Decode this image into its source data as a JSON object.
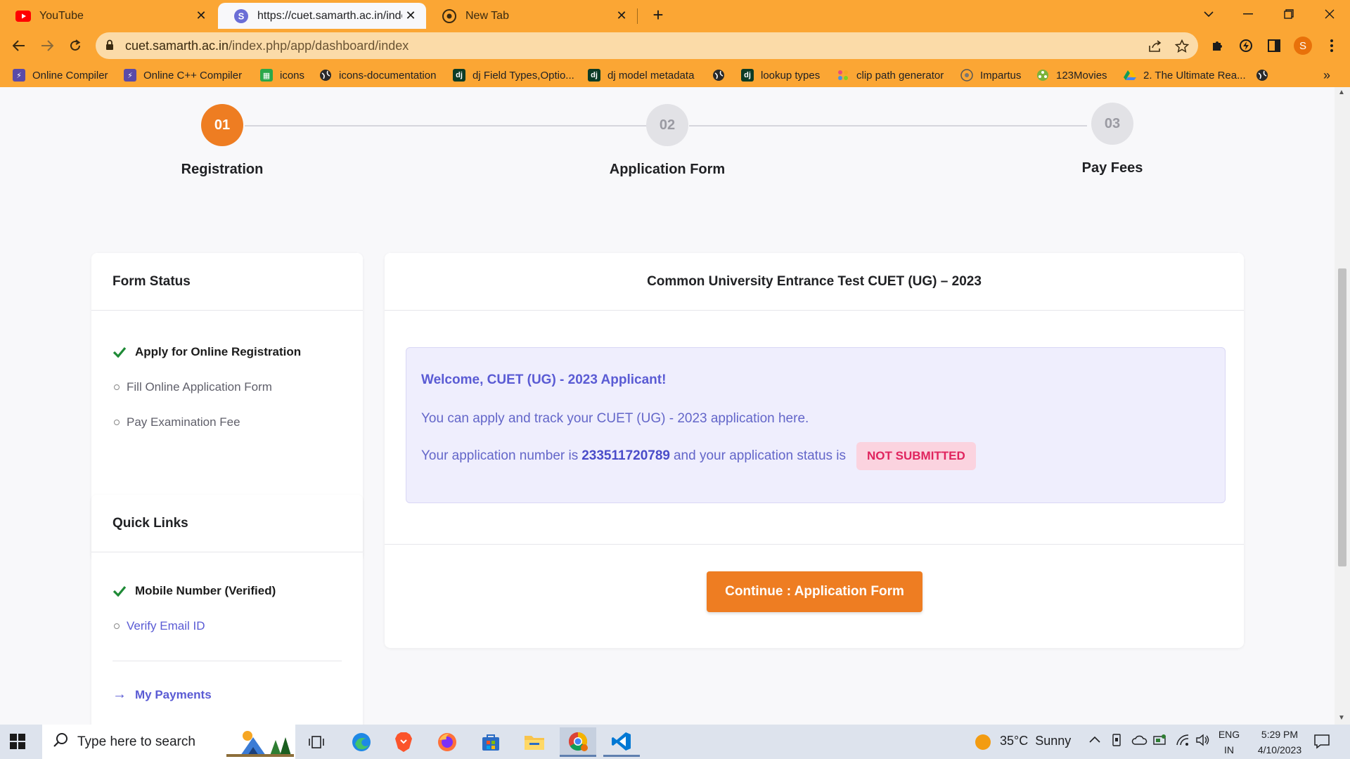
{
  "browser": {
    "tabs": [
      {
        "title": "YouTube",
        "active": false
      },
      {
        "title": "https://cuet.samarth.ac.in/index.p",
        "active": true
      },
      {
        "title": "New Tab",
        "active": false
      }
    ],
    "url": {
      "domain": "cuet.samarth.ac.in",
      "path": "/index.php/app/dashboard/index"
    },
    "profile_initial": "S",
    "bookmarks": [
      {
        "label": "Online Compiler",
        "icon": "bolt-icon"
      },
      {
        "label": "Online C++ Compiler",
        "icon": "bolt-icon"
      },
      {
        "label": "icons",
        "icon": "grid-icon"
      },
      {
        "label": "icons-documentation",
        "icon": "globe-icon"
      },
      {
        "label": "dj Field Types,Optio...",
        "icon": "django-icon"
      },
      {
        "label": "dj model metadata",
        "icon": "django-icon"
      },
      {
        "label": "",
        "icon": "globe-icon"
      },
      {
        "label": "lookup types",
        "icon": "django-icon"
      },
      {
        "label": "clip path generator",
        "icon": "dots-icon"
      },
      {
        "label": "Impartus",
        "icon": "impartus-icon"
      },
      {
        "label": "123Movies",
        "icon": "film-icon"
      },
      {
        "label": "2. The Ultimate Rea...",
        "icon": "drive-icon"
      }
    ]
  },
  "steps": [
    {
      "number": "01",
      "label": "Registration",
      "state": "done"
    },
    {
      "number": "02",
      "label": "Application Form",
      "state": "todo"
    },
    {
      "number": "03",
      "label": "Pay Fees",
      "state": "todo"
    }
  ],
  "form_status": {
    "title": "Form Status",
    "items": [
      {
        "label": "Apply for Online Registration",
        "done": true
      },
      {
        "label": "Fill Online Application Form",
        "done": false
      },
      {
        "label": "Pay Examination Fee",
        "done": false
      }
    ]
  },
  "quick_links": {
    "title": "Quick Links",
    "items": [
      {
        "label": "Mobile Number (Verified)",
        "done": true
      },
      {
        "label": "Verify Email ID",
        "done": false
      }
    ],
    "payments": "My Payments"
  },
  "main": {
    "title": "Common University Entrance Test CUET (UG) – 2023",
    "welcome": "Welcome, CUET (UG) - 2023 Applicant!",
    "track_text": "You can apply and track your CUET (UG) - 2023 application here.",
    "app_number_prefix": "Your application number is",
    "app_number": "233511720789",
    "status_prefix": "and your application status is",
    "status": "NOT SUBMITTED",
    "cta": "Continue : Application Form"
  },
  "colors": {
    "accent": "#ee7d22",
    "link": "#5a5bd4",
    "badge_text": "#e0245e",
    "browser": "#fba634"
  },
  "taskbar": {
    "search_placeholder": "Type here to search",
    "weather": "35°C  Sunny",
    "lang_top": "ENG",
    "lang_bottom": "IN",
    "time": "5:29 PM",
    "date": "4/10/2023"
  }
}
